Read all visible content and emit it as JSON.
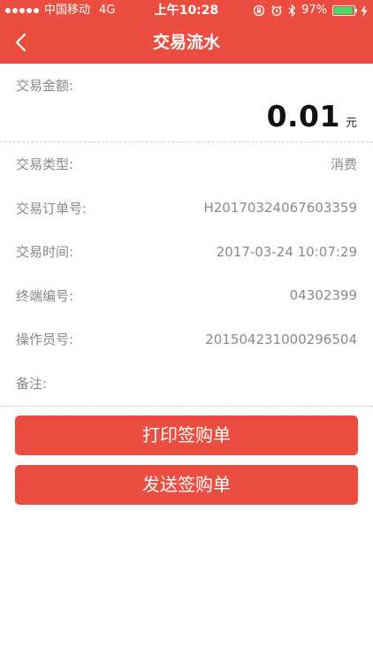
{
  "status_bar": {
    "carrier": "中国移动",
    "network": "4G",
    "time": "上午10:28",
    "battery_percent": "97%",
    "battery_level": 0.97,
    "icons": [
      "signal-dots-icon",
      "lock-rotation-icon",
      "alarm-icon",
      "bluetooth-icon",
      "battery-icon",
      "charging-bolt-icon"
    ]
  },
  "nav": {
    "title": "交易流水",
    "back_icon": "chevron-left-icon"
  },
  "amount": {
    "label": "交易金额:",
    "value": "0.01",
    "unit": "元"
  },
  "details": [
    {
      "label": "交易类型:",
      "value": "消费"
    },
    {
      "label": "交易订单号:",
      "value": "H20170324067603359"
    },
    {
      "label": "交易时间:",
      "value": "2017-03-24 10:07:29"
    },
    {
      "label": "终端编号:",
      "value": "04302399"
    },
    {
      "label": "操作员号:",
      "value": "201504231000296504"
    },
    {
      "label": "备注:",
      "value": ""
    }
  ],
  "buttons": {
    "print_label": "打印签购单",
    "send_label": "发送签购单"
  },
  "colors": {
    "accent": "#eb4d40",
    "battery_green": "#4cd964"
  }
}
